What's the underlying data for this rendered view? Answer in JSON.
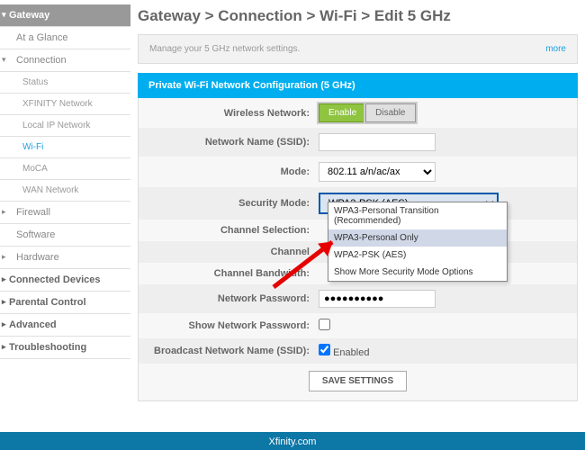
{
  "nav": {
    "gateway": "Gateway",
    "at_a_glance": "At a Glance",
    "connection": "Connection",
    "status": "Status",
    "xfinity_network": "XFINITY Network",
    "local_ip": "Local IP Network",
    "wifi": "Wi-Fi",
    "moca": "MoCA",
    "wan": "WAN Network",
    "firewall": "Firewall",
    "software": "Software",
    "hardware": "Hardware",
    "connected_devices": "Connected Devices",
    "parental_control": "Parental Control",
    "advanced": "Advanced",
    "troubleshooting": "Troubleshooting"
  },
  "breadcrumb": "Gateway > Connection > Wi-Fi > Edit 5 GHz",
  "notice": {
    "text": "Manage your 5 GHz network settings.",
    "more": "more"
  },
  "panel_title": "Private Wi-Fi Network Configuration (5 GHz)",
  "form": {
    "wireless_label": "Wireless Network:",
    "enable": "Enable",
    "disable": "Disable",
    "ssid_label": "Network Name (SSID):",
    "ssid_value": "",
    "mode_label": "Mode:",
    "mode_value": "802.11 a/n/ac/ax",
    "security_label": "Security Mode:",
    "security_value": "WPA2-PSK (AES)",
    "security_options": {
      "o1": "WPA3-Personal Transition (Recommended)",
      "o2": "WPA3-Personal Only",
      "o3": "WPA2-PSK (AES)",
      "o4": "Show More Security Mode Options"
    },
    "channel_sel_label": "Channel Selection:",
    "channel_label": "Channel",
    "bandwidth_label": "Channel Bandwidth:",
    "password_label": "Network Password:",
    "password_value": "●●●●●●●●●●",
    "show_pw_label": "Show Network Password:",
    "broadcast_label": "Broadcast Network Name (SSID):",
    "broadcast_enabled": "Enabled",
    "save": "SAVE SETTINGS"
  },
  "footer": "Xfinity.com"
}
